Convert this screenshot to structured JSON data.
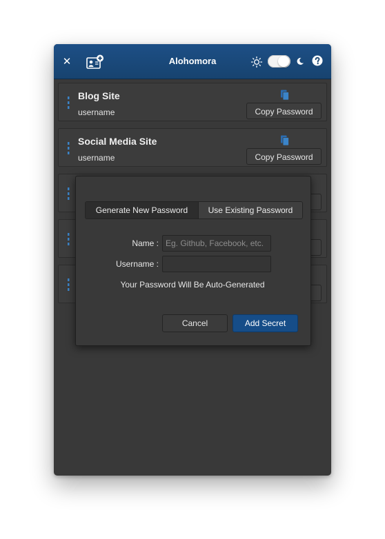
{
  "header": {
    "title": "Alohomora",
    "close_icon": "close-icon",
    "add_icon": "add-secret-icon",
    "theme_light_icon": "sun-icon",
    "theme_dark_icon": "moon-icon",
    "help_icon": "help-icon",
    "accent_color": "#1a4a7f"
  },
  "secrets": [
    {
      "name": "Blog Site",
      "username": "username",
      "copy_label": "Copy Password"
    },
    {
      "name": "Social Media Site",
      "username": "username",
      "copy_label": "Copy Password"
    },
    {
      "name": "",
      "username": "",
      "copy_label": "d"
    },
    {
      "name": "",
      "username": "",
      "copy_label": "d"
    },
    {
      "name": "",
      "username": "",
      "copy_label": "d"
    }
  ],
  "dialog": {
    "tabs": [
      {
        "label": "Generate New Password",
        "active": true
      },
      {
        "label": "Use Existing Password",
        "active": false
      }
    ],
    "name_label": "Name :",
    "name_placeholder": "Eg. Github, Facebook, etc.",
    "name_value": "",
    "username_label": "Username :",
    "username_value": "",
    "info": "Your Password Will Be Auto-Generated",
    "cancel_label": "Cancel",
    "add_label": "Add Secret",
    "primary_color": "#164d88"
  }
}
